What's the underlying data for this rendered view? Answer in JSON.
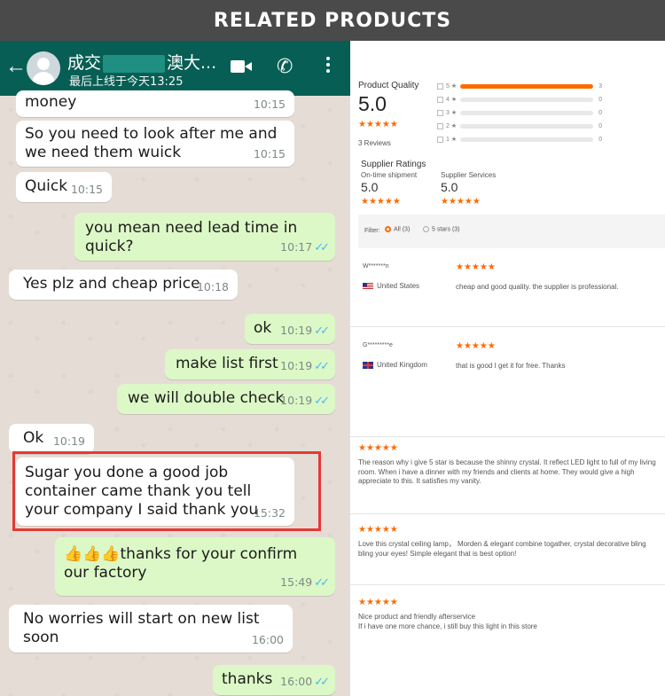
{
  "banner": {
    "title": "RELATED PRODUCTS"
  },
  "chat": {
    "header": {
      "name_left": "成交",
      "name_right": "澳大...",
      "last_seen": "最后上线于今天13:25"
    },
    "messages": [
      {
        "dir": "in",
        "text": "money",
        "time": "10:15"
      },
      {
        "dir": "in",
        "text": "So you need to look after me and we need them wuick",
        "time": "10:15"
      },
      {
        "dir": "in",
        "text": "Quick",
        "time": "10:15"
      },
      {
        "dir": "out",
        "text": "you mean need lead time in quick?",
        "time": "10:17"
      },
      {
        "dir": "in",
        "text": "Yes plz and cheap price",
        "time": "10:18"
      },
      {
        "dir": "out",
        "text": "ok",
        "time": "10:19"
      },
      {
        "dir": "out",
        "text": "make list first",
        "time": "10:19"
      },
      {
        "dir": "out",
        "text": "we will double check",
        "time": "10:19"
      },
      {
        "dir": "in",
        "text": "Ok",
        "time": "10:19"
      },
      {
        "dir": "in",
        "text": "Sugar you done a good job container came thank you tell your company I said thank you",
        "time": "15:32"
      },
      {
        "dir": "out",
        "text": "👍👍👍thanks for your confirm our factory",
        "time": "15:49"
      },
      {
        "dir": "in",
        "text": "No worries will start on new list soon",
        "time": "16:00"
      },
      {
        "dir": "out",
        "text": "thanks",
        "time": "16:00"
      }
    ]
  },
  "reviews": {
    "product_quality_label": "Product Quality",
    "product_quality_score": "5.0",
    "stars": "★★★★★",
    "reviews_count": "3 Reviews",
    "distribution": [
      {
        "stars": "5 ★",
        "count": "3",
        "fraction": 1.0
      },
      {
        "stars": "4 ★",
        "count": "0",
        "fraction": 0
      },
      {
        "stars": "3 ★",
        "count": "0",
        "fraction": 0
      },
      {
        "stars": "2 ★",
        "count": "0",
        "fraction": 0
      },
      {
        "stars": "1 ★",
        "count": "0",
        "fraction": 0
      }
    ],
    "supplier_ratings_label": "Supplier Ratings",
    "ontime_label": "On-time shipment",
    "ontime_score": "5.0",
    "services_label": "Supplier Services",
    "services_score": "5.0",
    "filter_label": "Filter:",
    "filter_all": "All (3)",
    "filter_5": "5 stars (3)",
    "items": [
      {
        "user": "W*******n",
        "country": "United States",
        "text": "cheap and good quality. the supplier is professional."
      },
      {
        "user": "G*********e",
        "country": "United Kingdom",
        "text": "that is good I get it for free. Thanks"
      }
    ],
    "extra": [
      {
        "text": "The reason why i give 5 star is because the shinny crystal. It reflect LED light to full of my living room. When i have a dinner with my friends and clients at home. They would give a high appreciate to this. It satisfies my vanity."
      },
      {
        "text": "Love this crystal ceiling lamp，  Morden & elegant combine togather, crystal decorative bling bling your eyes! Simple elegant that is best option!"
      },
      {
        "text": "Nice product and friendly afterservice\nIf i have one more chance, i still buy this light in this store"
      }
    ]
  }
}
